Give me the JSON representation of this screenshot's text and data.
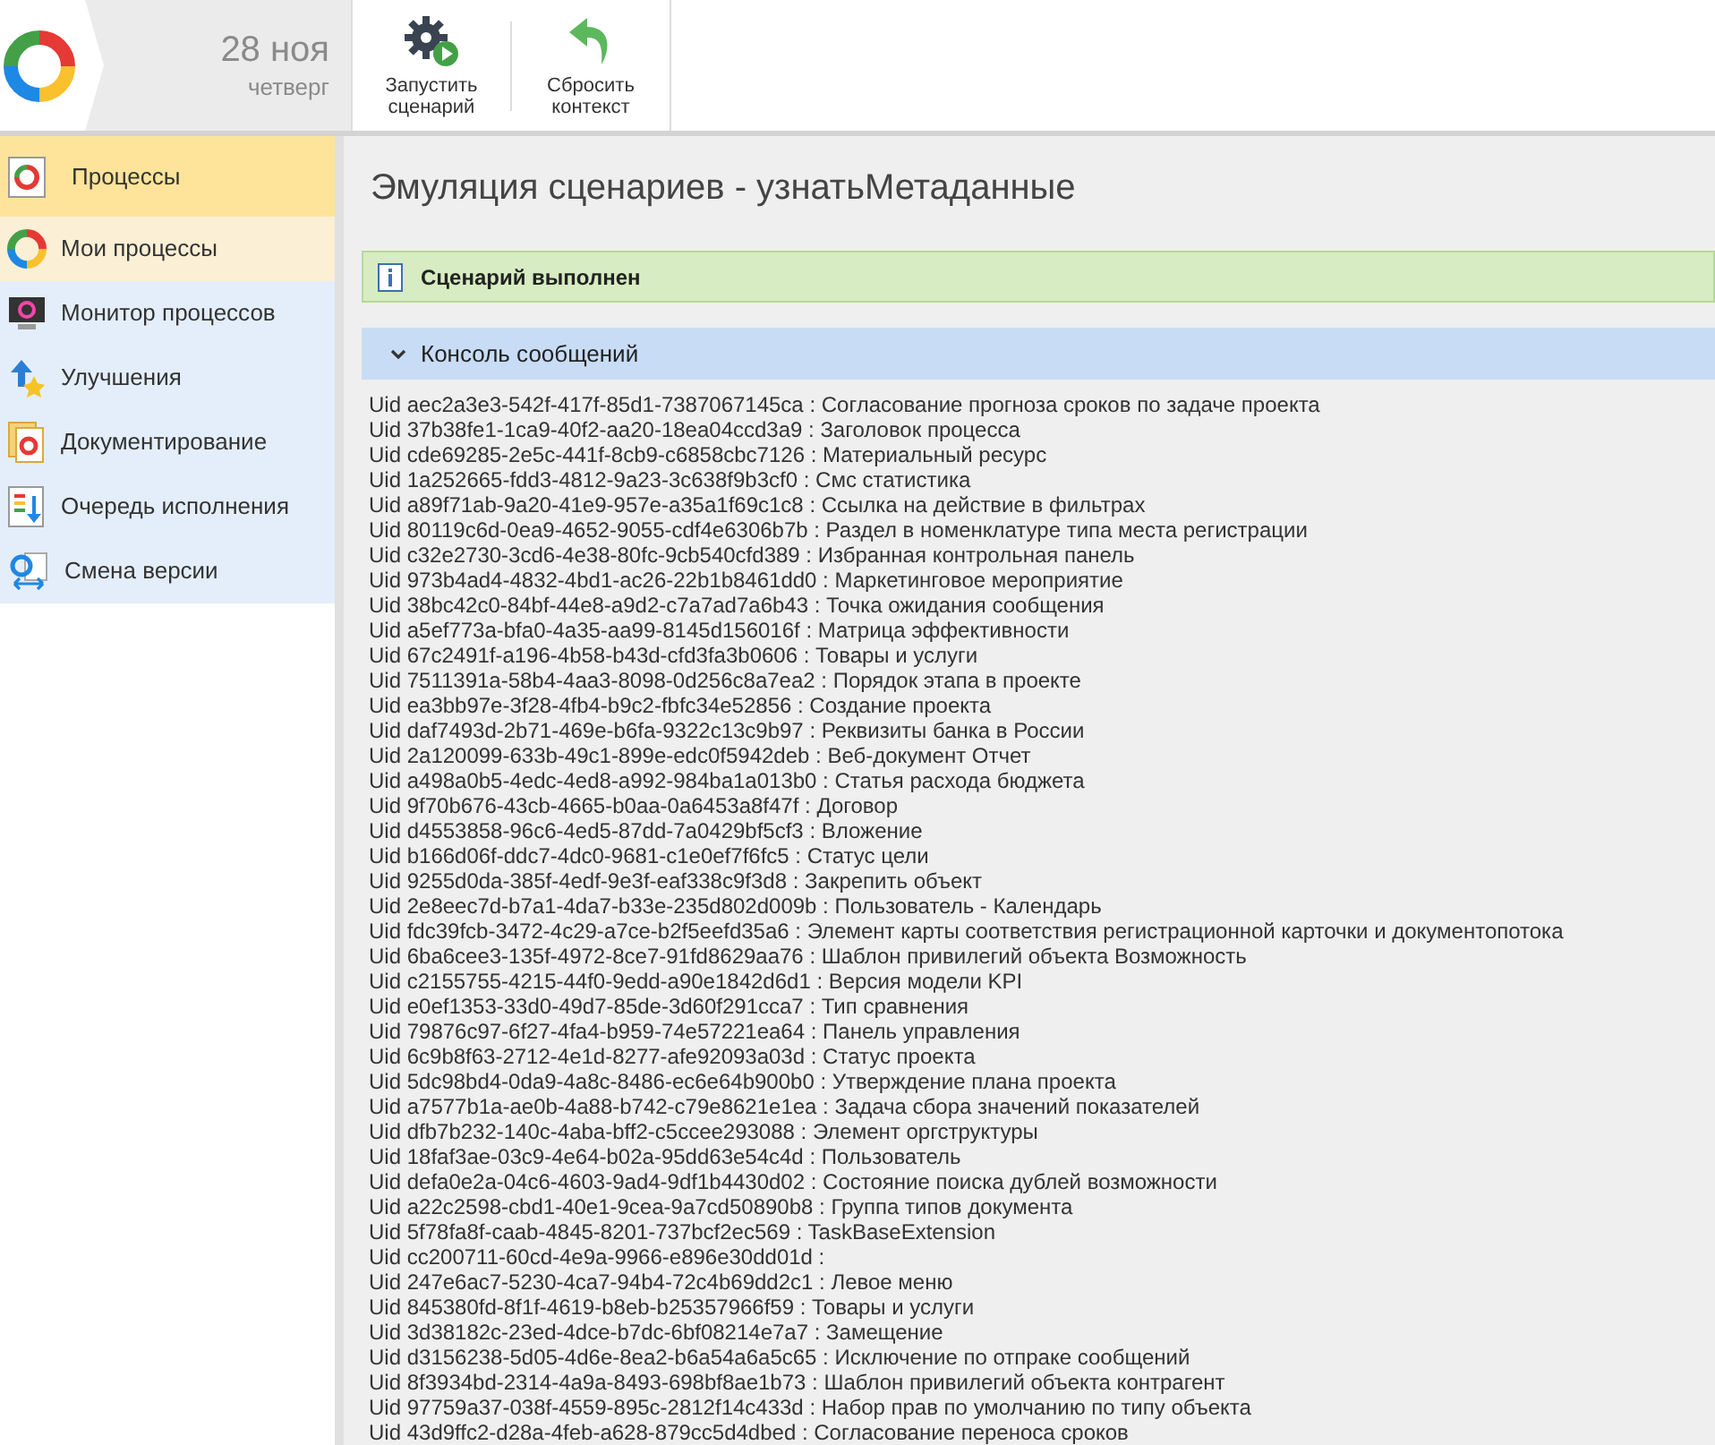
{
  "header": {
    "date": "28 ноя",
    "weekday": "четверг",
    "toolbar": [
      {
        "kind": "run",
        "label": "Запустить\nсценарий"
      },
      {
        "kind": "reset",
        "label": "Сбросить\nконтекст"
      }
    ]
  },
  "sidebar": {
    "items": [
      {
        "kind": "section",
        "label": "Процессы"
      },
      {
        "kind": "my",
        "label": "Мои процессы",
        "selected": true
      },
      {
        "kind": "monitor",
        "label": "Монитор процессов",
        "selected": false
      },
      {
        "kind": "improve",
        "label": "Улучшения",
        "selected": false
      },
      {
        "kind": "docs",
        "label": "Документирование",
        "selected": false
      },
      {
        "kind": "queue",
        "label": "Очередь исполнения",
        "selected": false
      },
      {
        "kind": "version",
        "label": "Смена версии",
        "selected": false
      }
    ]
  },
  "page": {
    "title": "Эмуляция сценариев - узнатьМетаданные",
    "status": "Сценарий выполнен",
    "console": {
      "title": "Консоль сообщений",
      "expanded": true,
      "lines": [
        "Uid aec2a3e3-542f-417f-85d1-7387067145ca : Согласование прогноза сроков по задаче проекта",
        "Uid 37b38fe1-1ca9-40f2-aa20-18ea04ccd3a9 : Заголовок процесса",
        "Uid cde69285-2e5c-441f-8cb9-c6858cbc7126 : Материальный ресурс",
        "Uid 1a252665-fdd3-4812-9a23-3c638f9b3cf0 : Смс статистика",
        "Uid a89f71ab-9a20-41e9-957e-a35a1f69c1c8 : Ссылка на действие в фильтрах",
        "Uid 80119c6d-0ea9-4652-9055-cdf4e6306b7b : Раздел в номенклатуре типа места регистрации",
        "Uid c32e2730-3cd6-4e38-80fc-9cb540cfd389 : Избранная контрольная панель",
        "Uid 973b4ad4-4832-4bd1-ac26-22b1b8461dd0 : Маркетинговое мероприятие",
        "Uid 38bc42c0-84bf-44e8-a9d2-c7a7ad7a6b43 : Точка ожидания сообщения",
        "Uid a5ef773a-bfa0-4a35-aa99-8145d156016f : Матрица эффективности",
        "Uid 67c2491f-a196-4b58-b43d-cfd3fa3b0606 : Товары и услуги",
        "Uid 7511391a-58b4-4aa3-8098-0d256c8a7ea2 : Порядок этапа в проекте",
        "Uid ea3bb97e-3f28-4fb4-b9c2-fbfc34e52856 : Создание проекта",
        "Uid daf7493d-2b71-469e-b6fa-9322c13c9b97 : Реквизиты банка в России",
        "Uid 2a120099-633b-49c1-899e-edc0f5942deb : Веб-документ Отчет",
        "Uid a498a0b5-4edc-4ed8-a992-984ba1a013b0 : Статья расхода бюджета",
        "Uid 9f70b676-43cb-4665-b0aa-0a6453a8f47f : Договор",
        "Uid d4553858-96c6-4ed5-87dd-7a0429bf5cf3 : Вложение",
        "Uid b166d06f-ddc7-4dc0-9681-c1e0ef7f6fc5 : Статус цели",
        "Uid 9255d0da-385f-4edf-9e3f-eaf338c9f3d8 : Закрепить объект",
        "Uid 2e8eec7d-b7a1-4da7-b33e-235d802d009b : Пользователь - Календарь",
        "Uid fdc39fcb-3472-4c29-a7ce-b2f5eefd35a6 : Элемент карты соответствия регистрационной карточки и документопотока",
        "Uid 6ba6cee3-135f-4972-8ce7-91fd8629aa76 : Шаблон привилегий объекта Возможность",
        "Uid c2155755-4215-44f0-9edd-a90e1842d6d1 : Версия модели KPI",
        "Uid e0ef1353-33d0-49d7-85de-3d60f291cca7 : Тип сравнения",
        "Uid 79876c97-6f27-4fa4-b959-74e57221ea64 : Панель управления",
        "Uid 6c9b8f63-2712-4e1d-8277-afe92093a03d : Статус проекта",
        "Uid 5dc98bd4-0da9-4a8c-8486-ec6e64b900b0 : Утверждение плана проекта",
        "Uid a7577b1a-ae0b-4a88-b742-c79e8621e1ea : Задача сбора значений показателей",
        "Uid dfb7b232-140c-4aba-bff2-c5ccee293088 : Элемент оргструктуры",
        "Uid 18faf3ae-03c9-4e64-b02a-95dd63e54c4d : Пользователь",
        "Uid defa0e2a-04c6-4603-9ad4-9df1b4430d02 : Состояние поиска дублей возможности",
        "Uid a22c2598-cbd1-40e1-9cea-9a7cd50890b8 : Группа типов документа",
        "Uid 5f78fa8f-caab-4845-8201-737bcf2ec569 : TaskBaseExtension",
        "Uid cc200711-60cd-4e9a-9966-e896e30dd01d :",
        "Uid 247e6ac7-5230-4ca7-94b4-72c4b69dd2c1 : Левое меню",
        "Uid 845380fd-8f1f-4619-b8eb-b25357966f59 : Товары и услуги",
        "Uid 3d38182c-23ed-4dce-b7dc-6bf08214e7a7 : Замещение",
        "Uid d3156238-5d05-4d6e-8ea2-b6a54a6a5c65 : Исключение по отпраке сообщений",
        "Uid 8f3934bd-2314-4a9a-8493-698bf8ae1b73 : Шаблон привилегий объекта контрагент",
        "Uid 97759a37-038f-4559-895c-2812f14c433d : Набор прав по умолчанию по типу объекта",
        "Uid 43d9ffc2-d28a-4feb-a628-879cc5d4dbed : Согласование переноса сроков"
      ]
    }
  }
}
